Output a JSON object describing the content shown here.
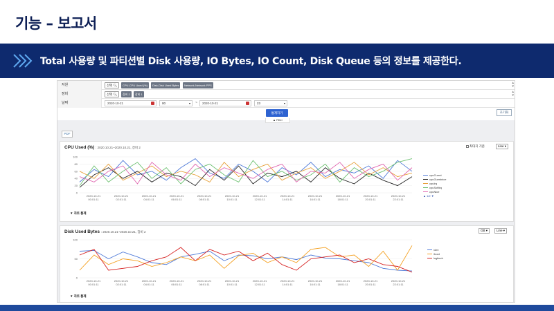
{
  "slide": {
    "title": "기능 – 보고서",
    "banner": "Total 사용량 및 파티션별 Disk 사용량, IO Bytes, IO Count, Disk Queue 등의 정보를 제공한다."
  },
  "filters": {
    "resource": {
      "label": "자원",
      "select_label": "선택",
      "tags": [
        "CPU-CPU Used (%)",
        "Disk-Disk Used Bytes",
        "Network-Network PPS"
      ]
    },
    "device": {
      "label": "장비",
      "select_label": "선택",
      "tags": [
        "장비 2",
        "장비 1"
      ]
    },
    "date": {
      "label": "날짜",
      "start_date": "2020-10-21",
      "start_hour": "00",
      "separator": "~",
      "end_date": "2020-10-21",
      "end_hour": "23"
    },
    "stat_button": "통계하기",
    "filter_toggle": "▲ Filter",
    "init_button": "초기화"
  },
  "pdf_button": "PDF",
  "cpu_chart": {
    "title": "CPU Used (%)",
    "subtitle": ": 2020.10.21~2020.10.21, 장비 2",
    "checkbox_label": "최대치 기준",
    "type_select": "Line",
    "legend_page": "1/2",
    "footer_toggle": "▼ 차트 통계",
    "legend": [
      {
        "name": "cpuCurrnt",
        "color": "#4e79d8"
      },
      {
        "name": "cpuGuestnice",
        "color": "#222222"
      },
      {
        "name": "cpuIrq",
        "color": "#e8a13a"
      },
      {
        "name": "cpuSoftirq",
        "color": "#6cc070"
      },
      {
        "name": "cpuNice",
        "color": "#e066b0"
      }
    ]
  },
  "disk_chart": {
    "title": "Disk Used Bytes",
    "subtitle": ": 2020.10.21~2020.10.21, 장비 2",
    "unit_select": "GB",
    "type_select": "Line",
    "footer_toggle": "▼ 차트 통계",
    "legend": [
      {
        "name": "/dev",
        "color": "#4e79d8"
      },
      {
        "name": "/boot",
        "color": "#f4a020"
      },
      {
        "name": "logitech",
        "color": "#d62020"
      }
    ]
  },
  "chart_data": [
    {
      "type": "line",
      "title": "CPU Used (%)",
      "ylim": [
        0,
        100
      ],
      "yticks": [
        0,
        20,
        40,
        60,
        80,
        100
      ],
      "xtick_labels": [
        [
          "2020-10-21",
          "00:01:11"
        ],
        [
          "2020-10-21",
          "02:01:11"
        ],
        [
          "2020-10-21",
          "04:01:11"
        ],
        [
          "2020-10-21",
          "06:01:11"
        ],
        [
          "2020-10-21",
          "08:01:11"
        ],
        [
          "2020-10-21",
          "10:01:11"
        ],
        [
          "2020-10-21",
          "12:01:11"
        ],
        [
          "2020-10-21",
          "14:01:11"
        ],
        [
          "2020-10-21",
          "16:01:11"
        ],
        [
          "2020-10-21",
          "18:01:11"
        ],
        [
          "2020-10-21",
          "20:01:11"
        ],
        [
          "2020-10-21",
          "22:01:11"
        ]
      ],
      "series": [
        {
          "name": "cpuCurrnt",
          "color": "#4e79d8",
          "values": [
            30,
            65,
            45,
            90,
            50,
            60,
            35,
            70,
            95,
            55,
            40,
            80,
            60,
            30,
            70,
            50,
            85,
            45,
            65,
            55,
            75,
            40,
            90,
            60
          ]
        },
        {
          "name": "cpuGuestnice",
          "color": "#222222",
          "values": [
            15,
            50,
            70,
            40,
            60,
            30,
            55,
            45,
            20,
            65,
            35,
            75,
            25,
            55,
            45,
            60,
            30,
            70,
            40,
            25,
            55,
            35,
            20,
            45
          ]
        },
        {
          "name": "cpuIrq",
          "color": "#e8a13a",
          "values": [
            60,
            40,
            80,
            35,
            55,
            75,
            45,
            60,
            50,
            30,
            85,
            45,
            65,
            80,
            35,
            55,
            70,
            40,
            60,
            85,
            50,
            70,
            45,
            55
          ]
        },
        {
          "name": "cpuSoftirq",
          "color": "#6cc070",
          "values": [
            20,
            75,
            30,
            60,
            85,
            40,
            70,
            25,
            65,
            80,
            50,
            30,
            90,
            45,
            60,
            35,
            50,
            80,
            30,
            70,
            45,
            60,
            85,
            95
          ]
        },
        {
          "name": "cpuNice",
          "color": "#e066b0",
          "values": [
            45,
            30,
            60,
            75,
            25,
            85,
            50,
            35,
            80,
            45,
            70,
            55,
            40,
            65,
            80,
            30,
            60,
            55,
            85,
            40,
            65,
            80,
            35,
            70
          ]
        }
      ]
    },
    {
      "type": "line",
      "title": "Disk Used Bytes",
      "ylim": [
        0,
        100
      ],
      "yticks": [
        0,
        50,
        100
      ],
      "xtick_labels": [
        [
          "2020-10-21",
          "00:01:11"
        ],
        [
          "2020-10-21",
          "02:01:11"
        ],
        [
          "2020-10-21",
          "04:01:11"
        ],
        [
          "2020-10-21",
          "06:01:11"
        ],
        [
          "2020-10-21",
          "08:01:11"
        ],
        [
          "2020-10-21",
          "10:01:11"
        ],
        [
          "2020-10-21",
          "12:01:11"
        ],
        [
          "2020-10-21",
          "14:01:11"
        ],
        [
          "2020-10-21",
          "16:01:11"
        ],
        [
          "2020-10-21",
          "18:01:11"
        ],
        [
          "2020-10-21",
          "20:01:11"
        ],
        [
          "2020-10-21",
          "22:01:11"
        ]
      ],
      "series": [
        {
          "name": "/dev",
          "color": "#4e79d8",
          "values": [
            70,
            72,
            50,
            68,
            55,
            40,
            35,
            55,
            62,
            70,
            45,
            60,
            58,
            50,
            55,
            48,
            60,
            52,
            50,
            45,
            40,
            25,
            20,
            18
          ]
        },
        {
          "name": "/boot",
          "color": "#f4a020",
          "values": [
            20,
            60,
            35,
            50,
            45,
            30,
            40,
            55,
            45,
            60,
            25,
            58,
            65,
            40,
            55,
            40,
            75,
            80,
            55,
            60,
            30,
            70,
            20,
            85
          ]
        },
        {
          "name": "logitech",
          "color": "#d62020",
          "values": [
            60,
            75,
            20,
            25,
            30,
            45,
            55,
            80,
            45,
            75,
            60,
            70,
            45,
            65,
            35,
            20,
            50,
            55,
            60,
            40,
            50,
            35,
            30,
            15
          ]
        }
      ]
    }
  ]
}
